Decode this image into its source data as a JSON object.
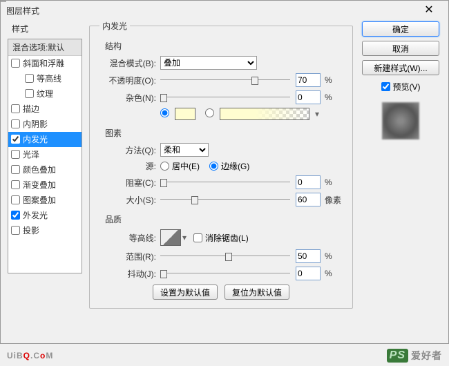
{
  "window": {
    "title": "图层样式",
    "close": "✕"
  },
  "left": {
    "header": "样式",
    "blend": "混合选项:默认",
    "items": [
      {
        "label": "斜面和浮雕",
        "checked": false,
        "indent": false
      },
      {
        "label": "等高线",
        "checked": false,
        "indent": true
      },
      {
        "label": "纹理",
        "checked": false,
        "indent": true
      },
      {
        "label": "描边",
        "checked": false,
        "indent": false
      },
      {
        "label": "内阴影",
        "checked": false,
        "indent": false
      },
      {
        "label": "内发光",
        "checked": true,
        "indent": false,
        "selected": true
      },
      {
        "label": "光泽",
        "checked": false,
        "indent": false
      },
      {
        "label": "颜色叠加",
        "checked": false,
        "indent": false
      },
      {
        "label": "渐变叠加",
        "checked": false,
        "indent": false
      },
      {
        "label": "图案叠加",
        "checked": false,
        "indent": false
      },
      {
        "label": "外发光",
        "checked": true,
        "indent": false
      },
      {
        "label": "投影",
        "checked": false,
        "indent": false
      }
    ]
  },
  "center": {
    "legend": "内发光",
    "structure": {
      "title": "结构",
      "blendMode": {
        "label": "混合模式(B):",
        "value": "叠加"
      },
      "opacity": {
        "label": "不透明度(O):",
        "value": "70",
        "unit": "%"
      },
      "noise": {
        "label": "杂色(N):",
        "value": "0",
        "unit": "%"
      },
      "swatchColor": "#fffdd0"
    },
    "elements": {
      "title": "图素",
      "method": {
        "label": "方法(Q):",
        "value": "柔和"
      },
      "sourceLabel": "源:",
      "center": "居中(E)",
      "edge": "边缘(G)",
      "choke": {
        "label": "阻塞(C):",
        "value": "0",
        "unit": "%"
      },
      "size": {
        "label": "大小(S):",
        "value": "60",
        "unit": "像素"
      }
    },
    "quality": {
      "title": "品质",
      "contourLabel": "等高线:",
      "antiAlias": "消除锯齿(L)",
      "range": {
        "label": "范围(R):",
        "value": "50",
        "unit": "%"
      },
      "jitter": {
        "label": "抖动(J):",
        "value": "0",
        "unit": "%"
      }
    },
    "defaults": {
      "set": "设置为默认值",
      "reset": "复位为默认值"
    }
  },
  "right": {
    "ok": "确定",
    "cancel": "取消",
    "newStyle": "新建样式(W)...",
    "preview": "预览(V)"
  }
}
